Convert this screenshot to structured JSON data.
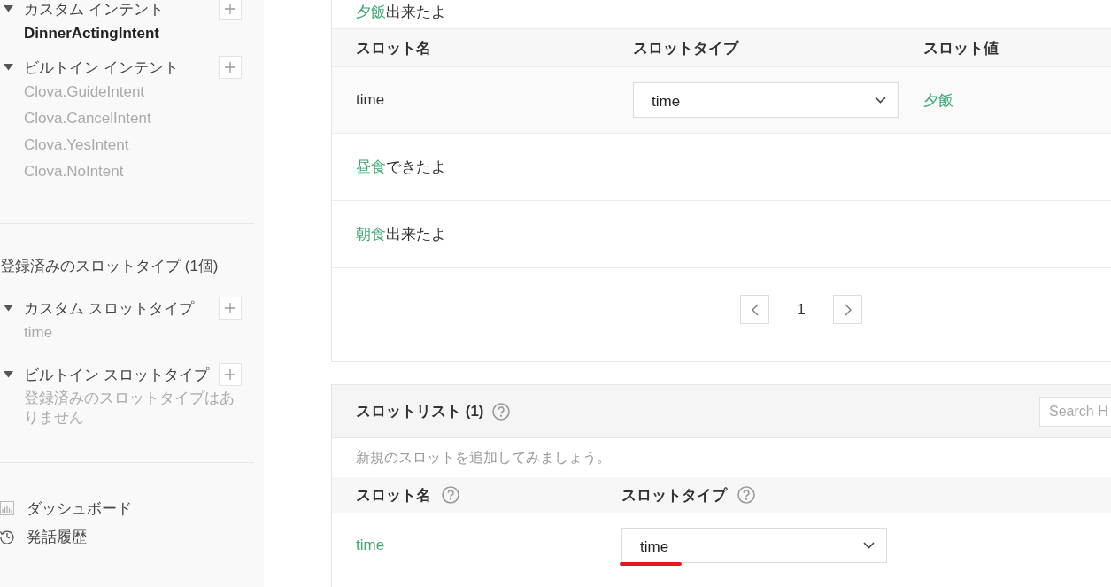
{
  "sidebar": {
    "intent_groups": [
      {
        "label": "カスタム インテント",
        "expanded": true,
        "items": [
          {
            "label": "DinnerActingIntent",
            "selected": true
          }
        ]
      },
      {
        "label": "ビルトイン インテント",
        "expanded": true,
        "items": [
          {
            "label": "Clova.GuideIntent",
            "selected": false
          },
          {
            "label": "Clova.CancelIntent",
            "selected": false
          },
          {
            "label": "Clova.YesIntent",
            "selected": false
          },
          {
            "label": "Clova.NoIntent",
            "selected": false
          }
        ]
      }
    ],
    "slot_types_title": "登録済みのスロットタイプ (1個)",
    "slot_type_groups": [
      {
        "label": "カスタム スロットタイプ",
        "expanded": true,
        "items": [
          {
            "label": "time",
            "selected": false
          }
        ]
      },
      {
        "label": "ビルトイン スロットタイプ",
        "expanded": true,
        "empty_text": "登録済みのスロットタイプはありません"
      }
    ],
    "nav": [
      {
        "kind": "dashboard",
        "label": "ダッシュボード"
      },
      {
        "kind": "history",
        "label": "発話履歴"
      }
    ]
  },
  "utterances": {
    "items": [
      {
        "highlight": "夕飯",
        "rest": "出来たよ",
        "slots": [
          {
            "name": "time",
            "type": "time",
            "value": "夕飯"
          }
        ]
      },
      {
        "highlight": "昼食",
        "rest": "できたよ"
      },
      {
        "highlight": "朝食",
        "rest": "出来たよ"
      }
    ],
    "slot_columns": [
      "スロット名",
      "スロットタイプ",
      "スロット値"
    ],
    "pagination": {
      "page": "1"
    }
  },
  "slot_list": {
    "title": "スロットリスト (1)",
    "search": {
      "placeholder": "Search H"
    },
    "hint": "新規のスロットを追加してみましょう。",
    "columns": [
      {
        "label": "スロット名",
        "help": true
      },
      {
        "label": "スロットタイプ",
        "help": true
      }
    ],
    "rows": [
      {
        "name": "time",
        "type": "time",
        "underlined": true
      }
    ]
  }
}
